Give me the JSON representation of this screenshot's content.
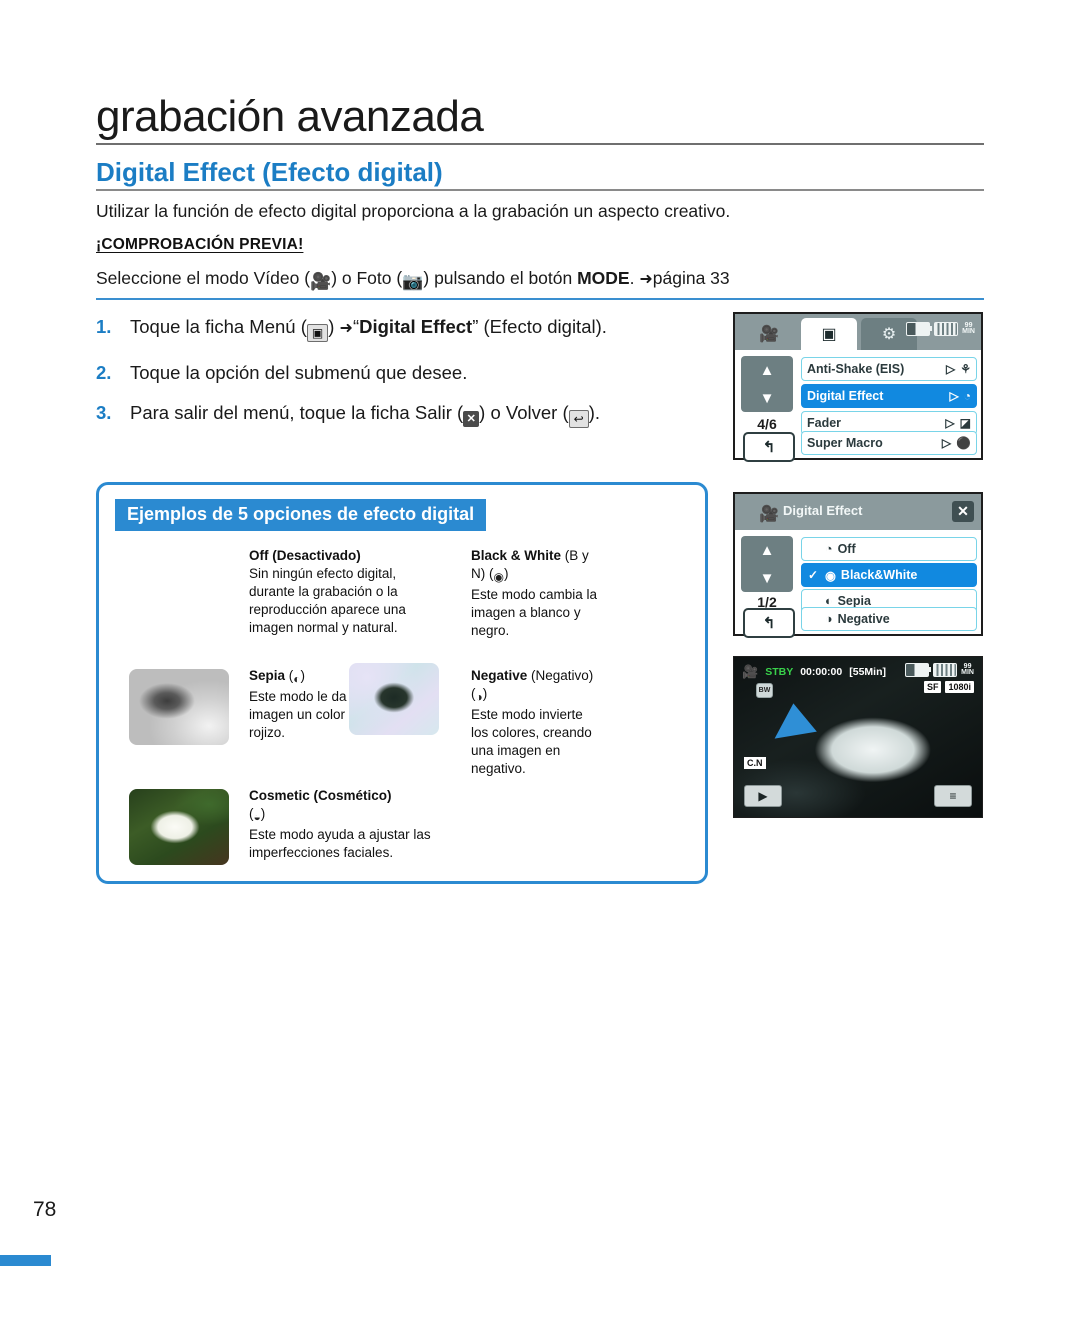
{
  "header": {
    "chapter_title": "grabación avanzada",
    "section_title": "Digital Effect (Efecto digital)",
    "intro": "Utilizar la función de efecto digital proporciona a la grabación un aspecto creativo.",
    "precheck_label": "¡COMPROBACIÓN PREVIA!",
    "precheck_parts": {
      "a": "Seleccione el modo Vídeo (",
      "b": ") o Foto (",
      "c": ") pulsando el botón ",
      "mode": "MODE",
      "d": ". ",
      "page_ref": "página 33"
    }
  },
  "steps": [
    {
      "num": "1.",
      "a": "Toque la ficha Menú (",
      "b": ") ",
      "bold": "Digital Effect",
      "quote_open": "“",
      "quote_close": "”",
      "c": " (Efecto digital)."
    },
    {
      "num": "2.",
      "a": "Toque la opción del submenú que desee."
    },
    {
      "num": "3.",
      "a": "Para salir del menú, toque la ficha Salir (",
      "b": ") o Volver (",
      "c": ")."
    }
  ],
  "examples": {
    "heading": "Ejemplos de 5 opciones de efecto digital",
    "items": [
      {
        "title": "Off (Desactivado)",
        "title_rest": "",
        "icon": "none",
        "body": "Sin ningún efecto digital, durante la grabación o la reproducción aparece una imagen normal y natural.",
        "thumb": "none"
      },
      {
        "title": "Black & White",
        "title_rest": " (B y N) (",
        "title_tail": ")",
        "icon": "bw-icon",
        "body": "Este modo cambia la imagen a blanco y negro.",
        "thumb": "none"
      },
      {
        "title": "Sepia",
        "title_rest": " (",
        "title_tail": ")",
        "icon": "sepia-icon",
        "body": "Este modo le da a la imagen un color marrón rojizo.",
        "thumb": "sepia"
      },
      {
        "title": "Negative",
        "title_rest": " (Negativo)",
        "title_tail": "( )",
        "icon": "negative-icon",
        "body": "Este modo invierte los colores, creando una imagen en negativo.",
        "thumb": "negative"
      },
      {
        "title": "Cosmetic (Cosmético)",
        "title_rest": "",
        "title_tail": "( )",
        "icon": "cosmetic-icon",
        "body": "Este modo ayuda a ajustar las imperfecciones faciales.",
        "thumb": "cosmetic"
      }
    ]
  },
  "lcd_menu": {
    "page_indicator": "4/6",
    "tabs": [
      "camcorder-tab",
      "menu-tab",
      "settings-tab"
    ],
    "battery_minutes": "99\nMIN",
    "items": [
      {
        "label": "Anti-Shake (EIS)",
        "selected": false,
        "arrow": "▷",
        "icon": "anti-shake-icon"
      },
      {
        "label": "Digital Effect",
        "selected": true,
        "arrow": "▷",
        "icon": "digital-effect-icon"
      },
      {
        "label": "Fader",
        "selected": false,
        "arrow": "▷",
        "icon": "fader-icon"
      },
      {
        "label": "Super Macro",
        "selected": false,
        "arrow": "▷",
        "icon": "super-macro-icon"
      }
    ],
    "back_label": "↰"
  },
  "lcd_submenu": {
    "title": "Digital Effect",
    "page_indicator": "1/2",
    "close_label": "✕",
    "back_label": "↰",
    "items": [
      {
        "label": "Off",
        "selected": false,
        "checked": false,
        "icon": "off-icon"
      },
      {
        "label": "Black&White",
        "selected": true,
        "checked": true,
        "icon": "bw-icon"
      },
      {
        "label": "Sepia",
        "selected": false,
        "checked": false,
        "icon": "sepia-icon"
      },
      {
        "label": "Negative",
        "selected": false,
        "checked": false,
        "icon": "negative-icon"
      }
    ]
  },
  "lcd_preview": {
    "status": "STBY",
    "timecode": "00:00:00",
    "remaining": "[55Min]",
    "battery_minutes": "99\nMIN",
    "quality_tag": "SF",
    "resolution_tag": "1080i",
    "effect_badge": "BW",
    "cn_badge": "C.N",
    "play_label": "▶",
    "menu_label": "≡"
  },
  "footer": {
    "page_number": "78"
  },
  "colors": {
    "accent_blue": "#2b8ad1",
    "heading_blue": "#1b7dc4",
    "lcd_select_blue": "#1189e0",
    "lcd_bar_gray": "#8b9a9d",
    "stby_green": "#39d14b"
  }
}
